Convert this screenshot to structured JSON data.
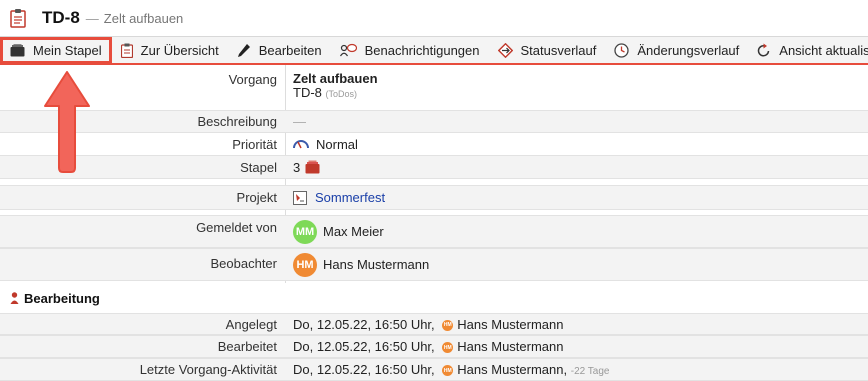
{
  "header": {
    "key": "TD-8",
    "separator": "—",
    "summary": "Zelt aufbauen"
  },
  "toolbar": {
    "items": [
      {
        "label": "Mein Stapel",
        "icon": "stack-icon"
      },
      {
        "label": "Zur Übersicht",
        "icon": "clipboard-icon"
      },
      {
        "label": "Bearbeiten",
        "icon": "pencil-icon"
      },
      {
        "label": "Benachrichtigungen",
        "icon": "notification-icon"
      },
      {
        "label": "Statusverlauf",
        "icon": "status-diamond-icon"
      },
      {
        "label": "Änderungsverlauf",
        "icon": "clock-icon"
      },
      {
        "label": "Ansicht aktualisieren",
        "icon": "refresh-icon"
      }
    ]
  },
  "details": {
    "vorgang_label": "Vorgang",
    "vorgang_title": "Zelt aufbauen",
    "vorgang_key": "TD-8",
    "vorgang_project_tag": "(ToDos)",
    "beschreibung_label": "Beschreibung",
    "beschreibung_value": "—",
    "prioritaet_label": "Priorität",
    "prioritaet_value": "Normal",
    "stapel_label": "Stapel",
    "stapel_value": "3",
    "projekt_label": "Projekt",
    "projekt_value": "Sommerfest",
    "gemeldet_label": "Gemeldet von",
    "gemeldet_initials": "MM",
    "gemeldet_name": "Max Meier",
    "beobachter_label": "Beobachter",
    "beobachter_initials": "HM",
    "beobachter_name": "Hans Mustermann"
  },
  "bearbeitung": {
    "title": "Bearbeitung",
    "rows": [
      {
        "label": "Angelegt",
        "value": "Do, 12.05.22, 16:50 Uhr,",
        "initials": "HM",
        "user": "Hans Mustermann",
        "suffix": ""
      },
      {
        "label": "Bearbeitet",
        "value": "Do, 12.05.22, 16:50 Uhr,",
        "initials": "HM",
        "user": "Hans Mustermann",
        "suffix": ""
      },
      {
        "label": "Letzte Vorgang-Aktivität",
        "value": "Do, 12.05.22, 16:50 Uhr,",
        "initials": "HM",
        "user": "Hans Mustermann,",
        "suffix": "-22 Tage"
      }
    ]
  },
  "colors": {
    "accent_red": "#e74c3c",
    "avatar_green": "#7ed957",
    "avatar_orange": "#f08a33",
    "link_blue": "#1a3fa8"
  }
}
